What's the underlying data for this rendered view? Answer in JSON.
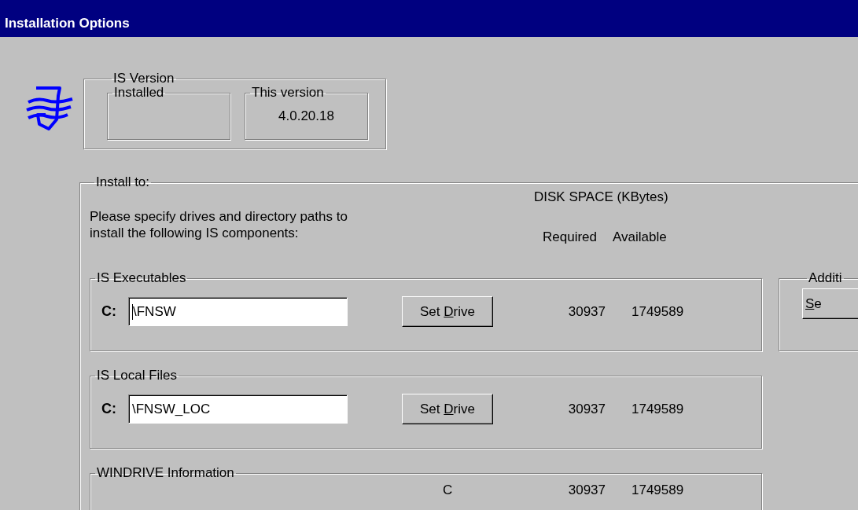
{
  "window": {
    "title": "Installation Options"
  },
  "is_version": {
    "label": "IS Version",
    "installed": {
      "label": "Installed"
    },
    "this_version": {
      "label": "This version",
      "value": "4.0.20.18"
    }
  },
  "install_to": {
    "label": "Install to:",
    "instructions": "Please specify drives and directory paths to\ninstall the following IS components:",
    "disk_space_heading": "DISK SPACE (KBytes)",
    "columns": [
      "Required",
      "Available"
    ],
    "components": [
      {
        "label": "IS Executables",
        "drive": "C:",
        "path": "\\FNSW",
        "focused": true,
        "button": {
          "before": "Set ",
          "key": "D",
          "after": "rive"
        },
        "required": "30937",
        "available": "1749589"
      },
      {
        "label": "IS Local Files",
        "drive": "C:",
        "path": "\\FNSW_LOC",
        "focused": false,
        "button": {
          "before": "Set ",
          "key": "D",
          "after": "rive"
        },
        "required": "30937",
        "available": "1749589"
      }
    ],
    "windrive": {
      "label": "WINDRIVE Information",
      "drive": "C",
      "required": "30937",
      "available": "1749589"
    },
    "additional": {
      "label": "Additi",
      "button": {
        "key": "S",
        "after": "e"
      }
    }
  }
}
